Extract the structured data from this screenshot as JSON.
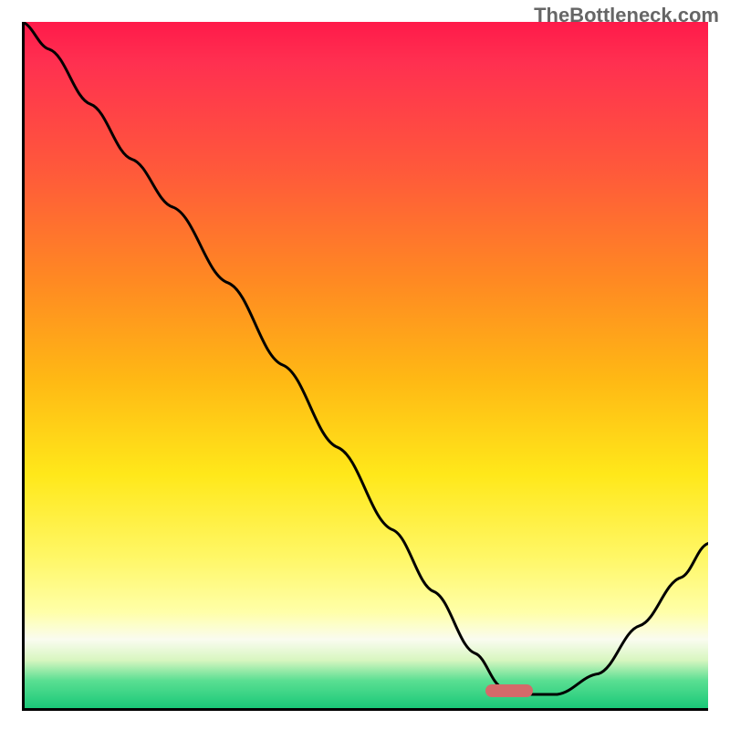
{
  "watermark": "TheBottleneck.com",
  "gradient_colors": {
    "top": "#ff1a4a",
    "upper_mid": "#ff8a22",
    "mid": "#ffe81a",
    "lower_mid": "#ffffa8",
    "bottom": "#1ac878"
  },
  "marker": {
    "color": "#d46a6a",
    "x_frac": 0.71,
    "y_frac": 0.975
  },
  "chart_data": {
    "type": "line",
    "title": "",
    "xlabel": "",
    "ylabel": "",
    "xlim": [
      0,
      1
    ],
    "ylim": [
      0,
      1
    ],
    "x": [
      0.0,
      0.04,
      0.1,
      0.16,
      0.22,
      0.3,
      0.38,
      0.46,
      0.54,
      0.6,
      0.66,
      0.7,
      0.74,
      0.78,
      0.84,
      0.9,
      0.96,
      1.0
    ],
    "values": [
      1.0,
      0.96,
      0.88,
      0.8,
      0.73,
      0.62,
      0.5,
      0.38,
      0.26,
      0.17,
      0.08,
      0.03,
      0.02,
      0.02,
      0.05,
      0.12,
      0.19,
      0.24
    ],
    "annotations": [],
    "legend": []
  }
}
